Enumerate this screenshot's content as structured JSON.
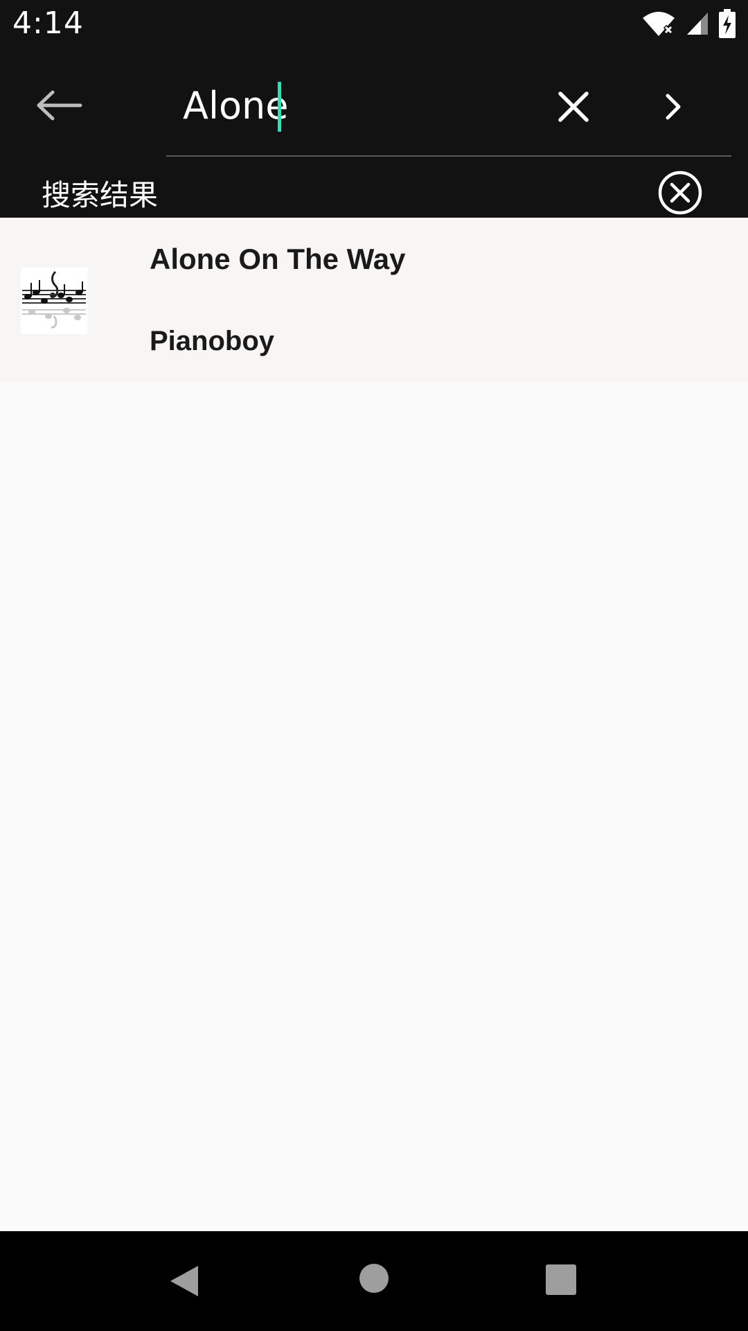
{
  "status_bar": {
    "time": "4:14",
    "icons": [
      "wifi-off-icon",
      "signal-icon",
      "battery-charging-icon"
    ]
  },
  "search": {
    "value": "Alone",
    "accent_color": "#1de9b6"
  },
  "results_header": {
    "label": "搜索结果"
  },
  "results": [
    {
      "title": "Alone On The Way",
      "artist": "Pianoboy",
      "art_icon": "music-notes-art"
    }
  ],
  "nav_bar": {
    "icons": [
      "back-triangle-icon",
      "home-circle-icon",
      "recents-square-icon"
    ]
  }
}
